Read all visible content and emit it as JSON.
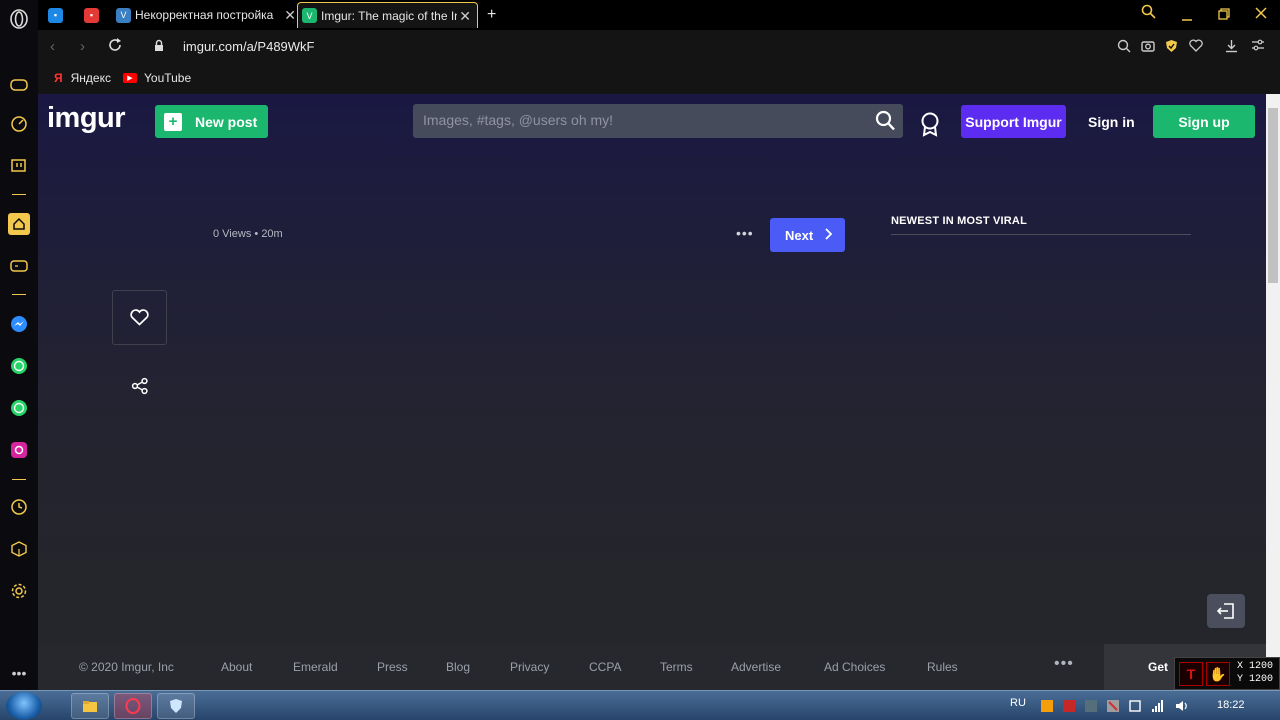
{
  "browser": {
    "tabs": [
      {
        "title": "",
        "favicon_color": "#1e88e5",
        "active": false
      },
      {
        "title": "",
        "favicon_color": "#e53935",
        "active": false
      },
      {
        "title": "Некорректная постройка",
        "favicon_color": "#3a7fc1",
        "active": false
      },
      {
        "title": "Imgur: The magic of the Int",
        "favicon_color": "#1bb76e",
        "active": true
      }
    ],
    "new_tab": "+",
    "url": "imgur.com/a/P489WkF",
    "bookmarks": [
      {
        "label": "Яндекс",
        "icon": "yandex-icon"
      },
      {
        "label": "YouTube",
        "icon": "youtube-icon"
      }
    ]
  },
  "site": {
    "logo": "imgur",
    "new_post": "New post",
    "search_placeholder": "Images, #tags, @users oh my!",
    "support": "Support Imgur",
    "sign_in": "Sign in",
    "sign_up": "Sign up",
    "accent_green": "#1bb76e",
    "accent_purple": "#5c2cf0",
    "accent_blue": "#4b5cf6"
  },
  "post": {
    "views": "0 Views",
    "time": "20m",
    "next": "Next",
    "more": "•••"
  },
  "sidebar_panel": {
    "title": "NEWEST IN MOST VIRAL"
  },
  "footer": {
    "items": [
      "© 2020 Imgur, Inc",
      "About",
      "Emerald",
      "Press",
      "Blog",
      "Privacy",
      "CCPA",
      "Terms",
      "Advertise",
      "Ad Choices",
      "Rules"
    ],
    "get_label": "Get"
  },
  "overlay": {
    "x": "X 1200",
    "y": "Y 1200"
  },
  "taskbar": {
    "lang": "RU",
    "time": "18:22"
  }
}
